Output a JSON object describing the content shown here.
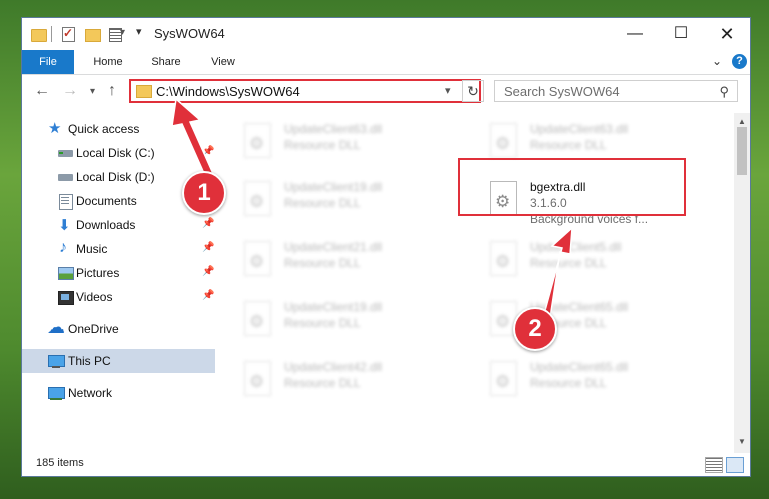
{
  "window": {
    "title": "SysWOW64",
    "controls": {
      "minimize": "—",
      "maximize": "☐",
      "close": "✕"
    }
  },
  "ribbon": {
    "tabs": [
      "File",
      "Home",
      "Share",
      "View"
    ],
    "expand_icon": "chevron-down-icon",
    "help": "?"
  },
  "address": {
    "path": "C:\\Windows\\SysWOW64",
    "search_placeholder": "Search SysWOW64"
  },
  "nav": {
    "items": [
      {
        "label": "Quick access",
        "icon": "star-icon",
        "pinned": false
      },
      {
        "label": "Local Disk (C:)",
        "icon": "drive-icon",
        "pinned": true
      },
      {
        "label": "Local Disk (D:)",
        "icon": "drive-icon",
        "pinned": false
      },
      {
        "label": "Documents",
        "icon": "documents-icon",
        "pinned": true
      },
      {
        "label": "Downloads",
        "icon": "downloads-icon",
        "pinned": true
      },
      {
        "label": "Music",
        "icon": "music-icon",
        "pinned": true
      },
      {
        "label": "Pictures",
        "icon": "pictures-icon",
        "pinned": true
      },
      {
        "label": "Videos",
        "icon": "videos-icon",
        "pinned": true
      },
      {
        "label": "OneDrive",
        "icon": "onedrive-icon",
        "pinned": false
      },
      {
        "label": "This PC",
        "icon": "pc-icon",
        "pinned": false,
        "selected": true
      },
      {
        "label": "Network",
        "icon": "network-icon",
        "pinned": false
      }
    ]
  },
  "files": {
    "left_column": [
      {
        "name": "UpdateClient63.dll",
        "type": "Resource DLL"
      },
      {
        "name": "UpdateClient19.dll",
        "type": "Resource DLL"
      },
      {
        "name": "UpdateClient21.dll",
        "type": "Resource DLL"
      },
      {
        "name": "UpdateClient19.dll",
        "type": "Resource DLL"
      },
      {
        "name": "UpdateClient42.dll",
        "type": "Resource DLL"
      }
    ],
    "right_column": [
      {
        "name": "UpdateClient63.dll",
        "type": "Resource DLL"
      },
      {
        "name": "UpdateClient5.dll",
        "type": "Resource DLL"
      },
      {
        "name": "UpdateClient65.dll",
        "type": "Resource DLL"
      },
      {
        "name": "UpdateClient65.dll",
        "type": "Resource DLL"
      }
    ],
    "highlighted": {
      "name": "bgextra.dll",
      "version": "3.1.6.0",
      "description": "Background voices f..."
    }
  },
  "status": {
    "item_count": "185 items"
  },
  "annotations": {
    "step1": "1",
    "step2": "2",
    "color": "#e0303a"
  }
}
